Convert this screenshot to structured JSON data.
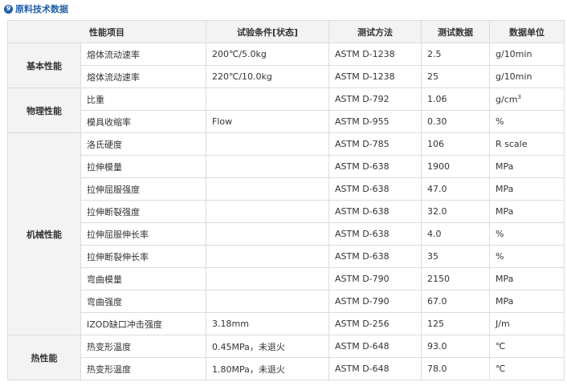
{
  "heading": {
    "icon": "circle-number-9-icon",
    "icon_glyph": "9",
    "text": "原料技术数据"
  },
  "columns": [
    "性能项目",
    "试验条件[状态]",
    "测试方法",
    "测试数据",
    "数据单位"
  ],
  "groups": [
    {
      "name": "基本性能",
      "rows": [
        {
          "item": "熔体流动速率",
          "condition": "200℃/5.0kg",
          "method": "ASTM D-1238",
          "value": "2.5",
          "unit": "g/10min"
        },
        {
          "item": "熔体流动速率",
          "condition": "220℃/10.0kg",
          "method": "ASTM D-1238",
          "value": "25",
          "unit": "g/10min"
        }
      ]
    },
    {
      "name": "物理性能",
      "rows": [
        {
          "item": "比重",
          "condition": "",
          "method": "ASTM D-792",
          "value": "1.06",
          "unit": "g/cm",
          "unit_sup": "3"
        },
        {
          "item": "模具收缩率",
          "condition": "Flow",
          "method": "ASTM D-955",
          "value": "0.30",
          "unit": "%"
        }
      ]
    },
    {
      "name": "机械性能",
      "rows": [
        {
          "item": "洛氏硬度",
          "condition": "",
          "method": "ASTM D-785",
          "value": "106",
          "unit": "R scale"
        },
        {
          "item": "拉伸模量",
          "condition": "",
          "method": "ASTM D-638",
          "value": "1900",
          "unit": "MPa"
        },
        {
          "item": "拉伸屈服强度",
          "condition": "",
          "method": "ASTM D-638",
          "value": "47.0",
          "unit": "MPa"
        },
        {
          "item": "拉伸断裂强度",
          "condition": "",
          "method": "ASTM D-638",
          "value": "32.0",
          "unit": "MPa"
        },
        {
          "item": "拉伸屈服伸长率",
          "condition": "",
          "method": "ASTM D-638",
          "value": "4.0",
          "unit": "%"
        },
        {
          "item": "拉伸断裂伸长率",
          "condition": "",
          "method": "ASTM D-638",
          "value": "35",
          "unit": "%"
        },
        {
          "item": "弯曲模量",
          "condition": "",
          "method": "ASTM D-790",
          "value": "2150",
          "unit": "MPa"
        },
        {
          "item": "弯曲强度",
          "condition": "",
          "method": "ASTM D-790",
          "value": "67.0",
          "unit": "MPa"
        },
        {
          "item": "IZOD缺口冲击强度",
          "condition": "3.18mm",
          "method": "ASTM D-256",
          "value": "125",
          "unit": "J/m"
        }
      ]
    },
    {
      "name": "热性能",
      "rows": [
        {
          "item": "热变形温度",
          "condition": "0.45MPa，未退火",
          "method": "ASTM D-648",
          "value": "93.0",
          "unit": "℃"
        },
        {
          "item": "热变形温度",
          "condition": "1.80MPa，未退火",
          "method": "ASTM D-648",
          "value": "78.0",
          "unit": "℃"
        }
      ]
    }
  ]
}
